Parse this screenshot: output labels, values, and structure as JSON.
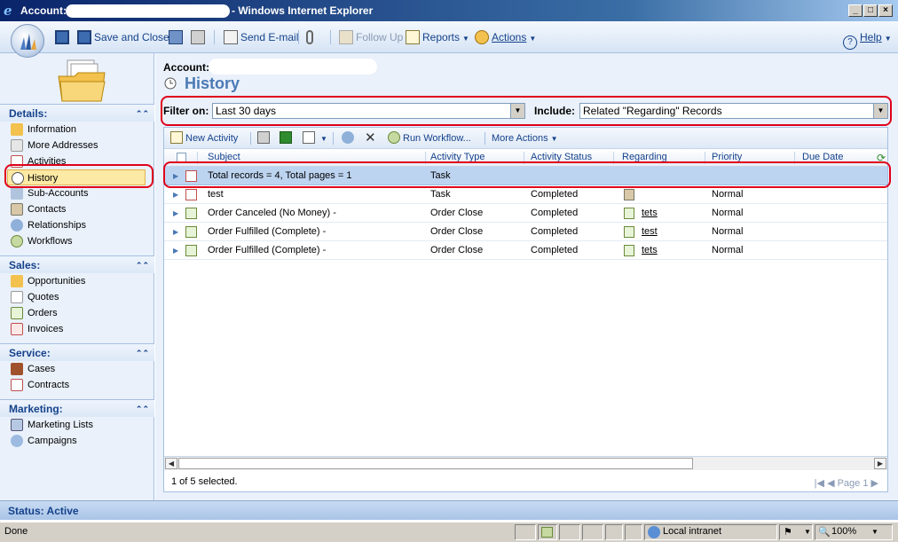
{
  "window": {
    "title_prefix": "Account:",
    "title_suffix": "- Windows Internet Explorer"
  },
  "toolbar": {
    "save_and_close": "Save and Close",
    "send_email": "Send E-mail",
    "follow_up": "Follow Up",
    "reports": "Reports",
    "actions": "Actions",
    "help": "Help"
  },
  "nav": {
    "details_title": "Details:",
    "details_items": [
      "Information",
      "More Addresses",
      "Activities",
      "History",
      "Sub-Accounts",
      "Contacts",
      "Relationships",
      "Workflows"
    ],
    "sales_title": "Sales:",
    "sales_items": [
      "Opportunities",
      "Quotes",
      "Orders",
      "Invoices"
    ],
    "service_title": "Service:",
    "service_items": [
      "Cases",
      "Contracts"
    ],
    "marketing_title": "Marketing:",
    "marketing_items": [
      "Marketing Lists",
      "Campaigns"
    ]
  },
  "main": {
    "account_label": "Account:",
    "page_title": "History",
    "filter_on_label": "Filter on:",
    "filter_on_value": "Last 30 days",
    "include_label": "Include:",
    "include_value": "Related \"Regarding\" Records"
  },
  "grid_toolbar": {
    "new_activity": "New Activity",
    "run_workflow": "Run Workflow...",
    "more_actions": "More Actions"
  },
  "grid": {
    "columns": [
      "Subject",
      "Activity Type",
      "Activity Status",
      "Regarding",
      "Priority",
      "Due Date"
    ],
    "rows": [
      {
        "subject": "Total records = 4, Total pages = 1",
        "type": "Task",
        "status": "",
        "regarding": "",
        "priority": ""
      },
      {
        "subject": "test",
        "type": "Task",
        "status": "Completed",
        "regarding": "",
        "priority": "Normal"
      },
      {
        "subject": "Order Canceled (No Money) -",
        "type": "Order Close",
        "status": "Completed",
        "regarding": "tets",
        "priority": "Normal"
      },
      {
        "subject": "Order Fulfilled (Complete) -",
        "type": "Order Close",
        "status": "Completed",
        "regarding": "test",
        "priority": "Normal"
      },
      {
        "subject": "Order Fulfilled (Complete) -",
        "type": "Order Close",
        "status": "Completed",
        "regarding": "tets",
        "priority": "Normal"
      }
    ],
    "selection_status": "1 of 5 selected.",
    "page_label": "Page 1"
  },
  "status": {
    "crm_status": "Status: Active",
    "ie_done": "Done",
    "zone": "Local intranet",
    "zoom": "100%"
  },
  "colors": {
    "accent": "#15428b",
    "title": "#4b79b5",
    "highlight": "#e0001b",
    "selected_row": "#bdd4f1"
  }
}
